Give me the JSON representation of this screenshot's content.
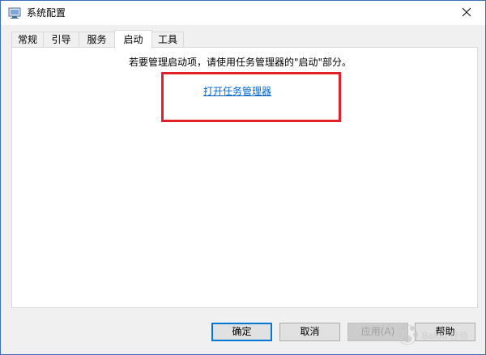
{
  "window": {
    "title": "系统配置",
    "close_glyph": "✕"
  },
  "tabs": [
    {
      "label": "常规",
      "active": false
    },
    {
      "label": "引导",
      "active": false
    },
    {
      "label": "服务",
      "active": false
    },
    {
      "label": "启动",
      "active": true
    },
    {
      "label": "工具",
      "active": false
    }
  ],
  "startup_panel": {
    "instruction": "若要管理启动项，请使用任务管理器的\"启动\"部分。",
    "open_task_manager_link": "打开任务管理器",
    "highlight_color": "#e0202a"
  },
  "buttons": {
    "ok": "确定",
    "cancel": "取消",
    "apply": "应用(A)",
    "help": "帮助"
  },
  "colors": {
    "accent": "#0078d7",
    "link": "#0066cc",
    "window_border": "#3c6fb4"
  },
  "icons": {
    "app": "system-config-icon",
    "close": "close-icon"
  },
  "watermark": {
    "text": "Baidu 经验"
  }
}
